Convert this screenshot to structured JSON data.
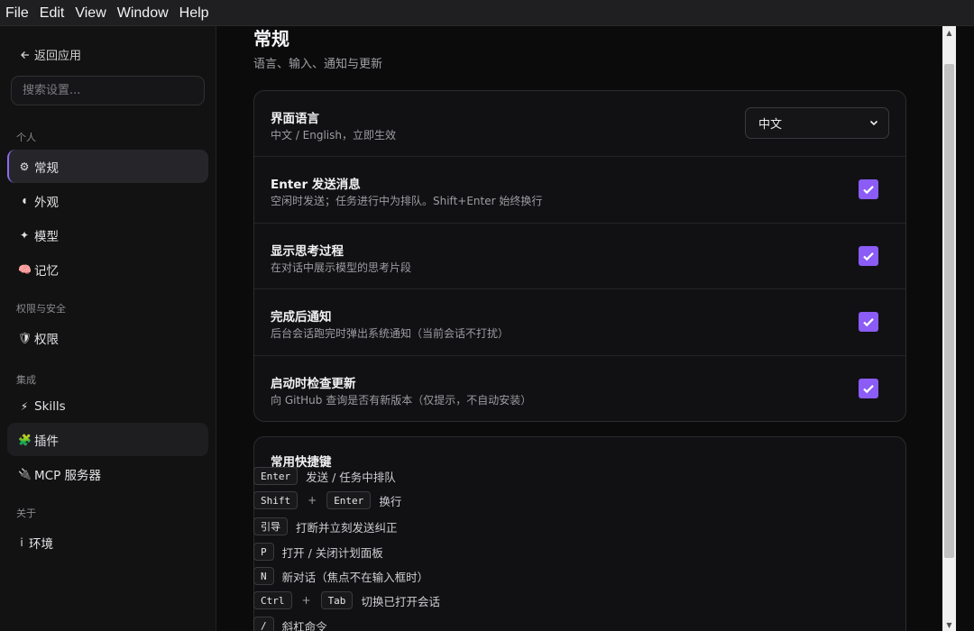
{
  "menubar": {
    "items": [
      "File",
      "Edit",
      "View",
      "Window",
      "Help"
    ]
  },
  "sidebar": {
    "back_label": "返回应用",
    "search_placeholder": "搜索设置...",
    "sections": [
      {
        "label": "个人"
      },
      {
        "label": "权限与安全"
      },
      {
        "label": "集成"
      },
      {
        "label": "关于"
      }
    ],
    "items": [
      {
        "icon": "⚙",
        "label": "常规"
      },
      {
        "icon": "◖",
        "label": "外观"
      },
      {
        "icon": "✦",
        "label": "模型"
      },
      {
        "icon": "🧠",
        "label": "记忆"
      },
      {
        "icon": "🛡",
        "label": "权限"
      },
      {
        "icon": "⚡",
        "label": "Skills"
      },
      {
        "icon": "🧩",
        "label": "插件"
      },
      {
        "icon": "🔌",
        "label": "MCP 服务器"
      },
      {
        "icon": "i",
        "label": "环境"
      }
    ]
  },
  "main": {
    "title": "常规",
    "subtitle": "语言、输入、通知与更新",
    "settings": [
      {
        "title": "界面语言",
        "desc": "中文 / English，立即生效",
        "select_value": "中文"
      },
      {
        "title": "Enter 发送消息",
        "desc": "空闲时发送；任务进行中为排队。Shift+Enter 始终换行",
        "checked": true
      },
      {
        "title": "显示思考过程",
        "desc": "在对话中展示模型的思考片段",
        "checked": true
      },
      {
        "title": "完成后通知",
        "desc": "后台会话跑完时弹出系统通知（当前会话不打扰）",
        "checked": true
      },
      {
        "title": "启动时检查更新",
        "desc": "向 GitHub 查询是否有新版本（仅提示，不自动安装）",
        "checked": true
      }
    ],
    "shortcuts": {
      "title": "常用快捷键",
      "rows": [
        {
          "keys": [
            "Enter"
          ],
          "desc": "发送 / 任务中排队"
        },
        {
          "keys": [
            "Shift",
            "Enter"
          ],
          "desc": "换行"
        },
        {
          "keys": [
            "引导"
          ],
          "desc": "打断并立刻发送纠正"
        },
        {
          "keys": [
            "P"
          ],
          "desc": "打开 / 关闭计划面板"
        },
        {
          "keys": [
            "N"
          ],
          "desc": "新对话（焦点不在输入框时）"
        },
        {
          "keys": [
            "Ctrl",
            "Tab"
          ],
          "desc": "切换已打开会话"
        },
        {
          "keys": [
            "/"
          ],
          "desc": "斜杠命令"
        }
      ],
      "plus": "+"
    }
  },
  "colors": {
    "accent": "#8b5cf6",
    "background": "#0b0b0c",
    "sidebar": "#121213"
  },
  "scrollbar": {
    "up_icon": "▲",
    "down_icon": "▼"
  }
}
